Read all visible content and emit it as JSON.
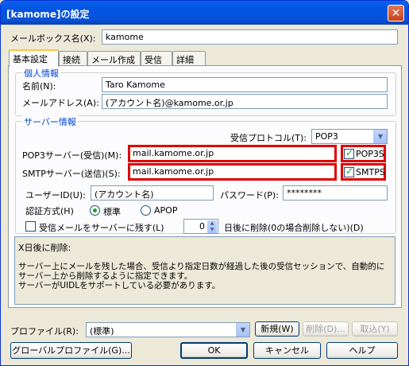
{
  "window": {
    "title": "[kamome]の設定",
    "close": "✕"
  },
  "mailbox": {
    "label": "メールボックス名(X):",
    "value": "kamome"
  },
  "tabs": [
    "基本設定",
    "接続",
    "メール作成",
    "受信",
    "詳細"
  ],
  "personal": {
    "title": "個人情報",
    "name_label": "名前(N):",
    "name_value": "Taro Kamome",
    "email_label": "メールアドレス(A):",
    "email_value": "(アカウント名)@kamome.or.jp"
  },
  "server": {
    "title": "サーバー情報",
    "protocol_label": "受信プロトコル(T):",
    "protocol_value": "POP3",
    "pop3_label": "POP3サーバー(受信)(M):",
    "pop3_value": "mail.kamome.or.jp",
    "pop3s_label": "POP3S",
    "pop3s_checked": true,
    "smtp_label": "SMTPサーバー(送信)(S):",
    "smtp_value": "mail.kamome.or.jp",
    "smtps_label": "SMTPS",
    "smtps_checked": true,
    "userid_label": "ユーザーID(U):",
    "userid_value": "(アカウント名)",
    "password_label": "パスワード(P):",
    "password_value": "********",
    "auth_label": "認証方式(H)",
    "auth_standard": "標準",
    "auth_apop": "APOP",
    "auth_selected": "標準",
    "leave_label": "受信メールをサーバーに残す(L)",
    "leave_checked": false,
    "days_value": "0",
    "delete_label": "日後に削除(0の場合削除しない)(D)"
  },
  "description": {
    "heading": "X日後に削除:",
    "text": "サーバー上にメールを残した場合、受信より指定日数が経過した後の受信セッションで、自動的にサーバー上から削除するように指定できます。\nサーバーがUIDLをサポートしている必要があります。"
  },
  "profile": {
    "label": "プロファイル(R):",
    "value": "(標準)",
    "new": "新規(W)",
    "delete": "削除(D)...",
    "cancel": "取込(Y)"
  },
  "buttons": {
    "global_profile": "グローバルプロファイル(G)...",
    "ok": "OK",
    "cancel": "キャンセル",
    "help": "ヘルプ"
  },
  "colors": {
    "highlight": "#e00000",
    "title_bar": "#0054e3",
    "group_title": "#0046d5"
  }
}
